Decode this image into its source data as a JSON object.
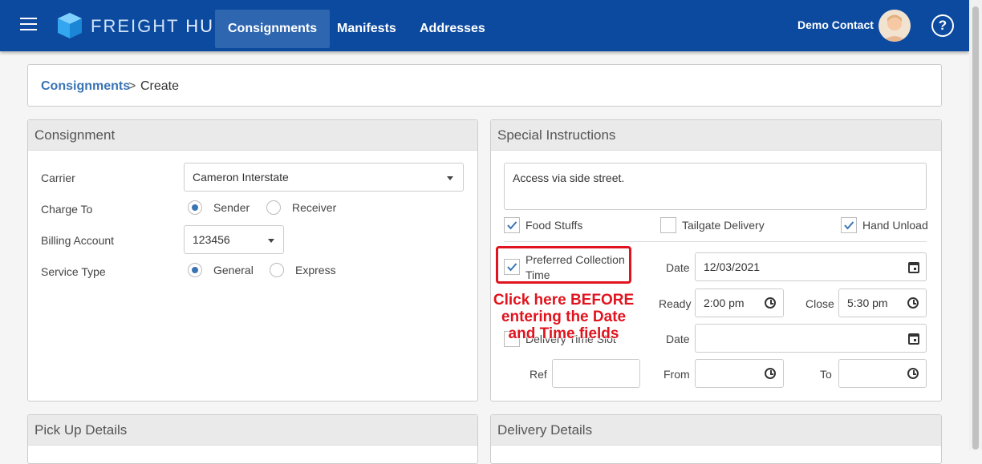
{
  "brand": {
    "freight": "FREIGHT",
    "hub": "HUB"
  },
  "nav": {
    "consignments": "Consignments",
    "manifests": "Manifests",
    "addresses": "Addresses"
  },
  "user": {
    "name": "Demo Contact"
  },
  "help_icon": "?",
  "breadcrumb": {
    "link": "Consignments",
    "separator": ">",
    "current": "Create"
  },
  "consignment": {
    "title": "Consignment",
    "carrier_label": "Carrier",
    "carrier_value": "Cameron Interstate",
    "charge_to_label": "Charge To",
    "charge_to_options": [
      "Sender",
      "Receiver"
    ],
    "charge_to_selected": "Sender",
    "billing_label": "Billing Account",
    "billing_value": "123456",
    "service_label": "Service Type",
    "service_options": [
      "General",
      "Express"
    ],
    "service_selected": "General"
  },
  "special": {
    "title": "Special Instructions",
    "instructions": "Access via side street.",
    "food_stuffs": {
      "label": "Food Stuffs",
      "checked": true
    },
    "tailgate": {
      "label": "Tailgate Delivery",
      "checked": false
    },
    "hand_unload": {
      "label": "Hand Unload",
      "checked": true
    },
    "preferred_collection": {
      "label_line1": "Preferred Collection",
      "label_line2": "Time",
      "checked": true
    },
    "collection_date_label": "Date",
    "collection_date": "12/03/2021",
    "ready_label": "Ready",
    "ready_time": "2:00 pm",
    "close_label": "Close",
    "close_time": "5:30 pm",
    "delivery_slot": {
      "label": "Delivery Time Slot",
      "checked": false
    },
    "delivery_date_label": "Date",
    "ref_label": "Ref",
    "from_label": "From",
    "to_label": "To"
  },
  "annotation": {
    "line1": "Click here BEFORE",
    "line2": "entering the Date",
    "line3": "and Time fields"
  },
  "pickup": {
    "title": "Pick Up Details"
  },
  "delivery": {
    "title": "Delivery Details"
  },
  "colors": {
    "header": "#0c4aa0",
    "active_nav": "#2f66b0",
    "link": "#3a74b5",
    "annotation": "#e0141e"
  }
}
